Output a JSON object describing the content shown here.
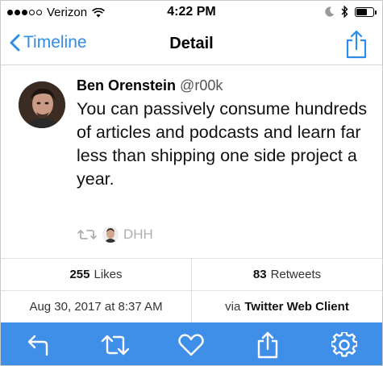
{
  "status_bar": {
    "carrier": "Verizon",
    "time": "4:22 PM",
    "battery_level": 0.65,
    "icons": [
      "signal-dots-icon",
      "wifi-icon",
      "moon-icon",
      "bluetooth-icon",
      "battery-icon"
    ]
  },
  "nav": {
    "back_label": "Timeline",
    "title": "Detail",
    "share_icon": "share-icon"
  },
  "tweet": {
    "author_name": "Ben Orenstein",
    "author_handle": "@r00k",
    "text": "You can passively consume hundreds of articles and podcasts and learn far less than shipping one side project a year.",
    "retweeted_by": "DHH"
  },
  "stats": {
    "likes_count": "255",
    "likes_label": "Likes",
    "retweets_count": "83",
    "retweets_label": "Retweets"
  },
  "meta": {
    "timestamp": "Aug 30, 2017 at 8:37 AM",
    "via_label": "via",
    "client": "Twitter Web Client"
  },
  "toolbar": {
    "color": "#3f8ee8",
    "icons": [
      "reply-icon",
      "retweet-icon",
      "like-icon",
      "share-icon",
      "settings-icon"
    ]
  },
  "colors": {
    "accent": "#2f8ce8"
  }
}
